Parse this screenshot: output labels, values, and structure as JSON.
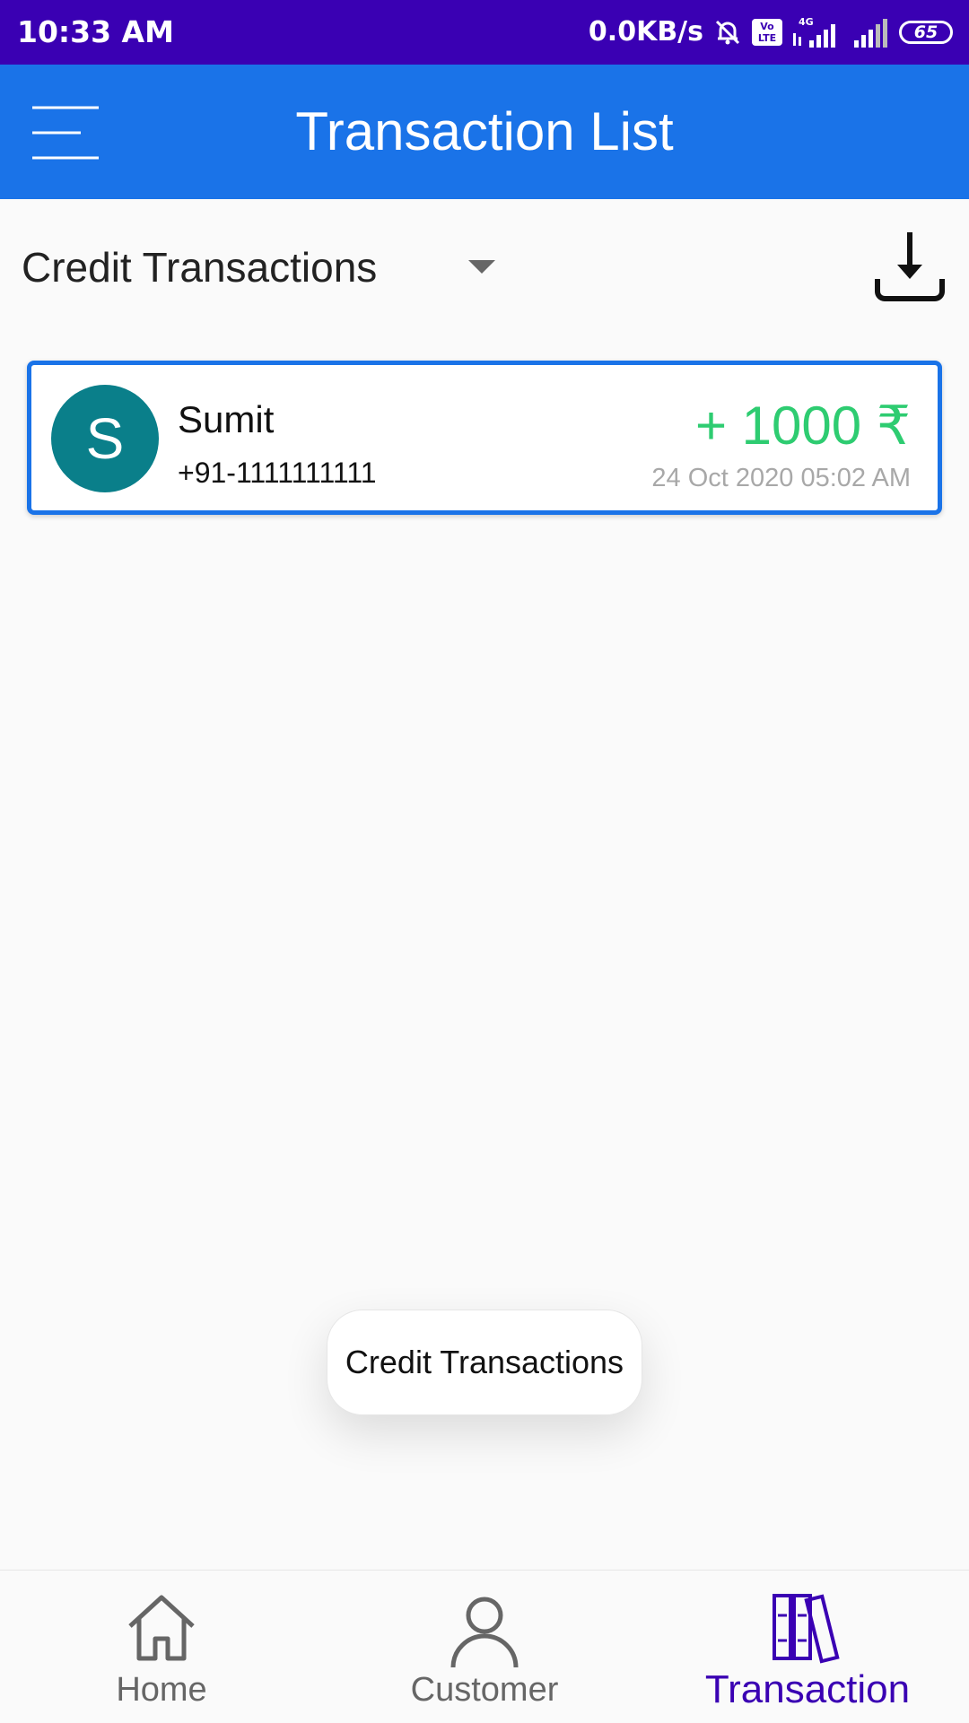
{
  "status_bar": {
    "time": "10:33 AM",
    "net_speed": "0.0KB/s",
    "volte": "Vo LTE",
    "network": "4G",
    "battery": "65"
  },
  "app_bar": {
    "title": "Transaction List",
    "menu_icon": "hamburger-menu-icon"
  },
  "filter": {
    "selected": "Credit Transactions",
    "download_icon": "download-icon"
  },
  "transactions": [
    {
      "initial": "S",
      "name": "Sumit",
      "phone": "+91-1111111111",
      "amount": "+ 1000 ₹",
      "date": "24 Oct 2020 05:02 AM"
    }
  ],
  "toast": {
    "text": "Credit Transactions"
  },
  "bottom_nav": {
    "items": [
      {
        "label": "Home",
        "icon": "home-icon",
        "active": false
      },
      {
        "label": "Customer",
        "icon": "person-icon",
        "active": false
      },
      {
        "label": "Transaction",
        "icon": "books-icon",
        "active": true
      }
    ]
  },
  "colors": {
    "status_bar": "#3a00b3",
    "app_bar": "#1a73e8",
    "credit_amount": "#2ecc71",
    "avatar": "#0a7f8a",
    "nav_active": "#3a00b3",
    "nav_inactive": "#666666"
  }
}
